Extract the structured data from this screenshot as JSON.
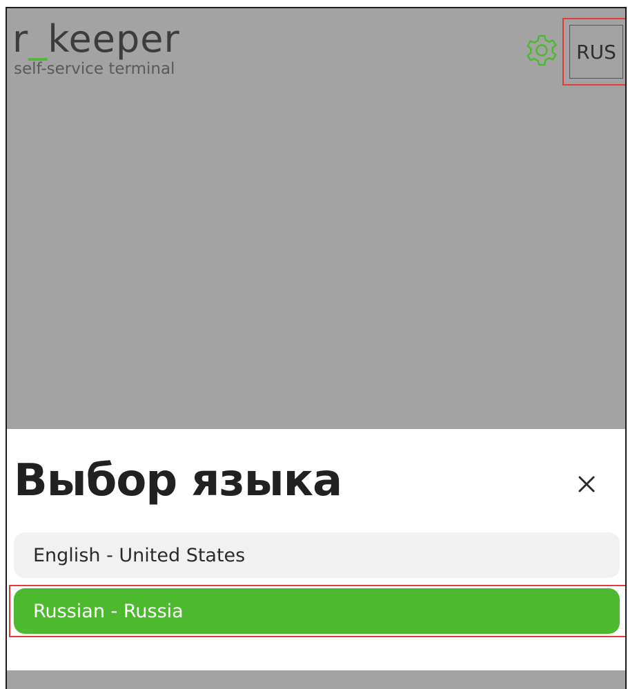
{
  "header": {
    "logo_main_prefix": "r",
    "logo_main_underscore": "_",
    "logo_main_suffix": "keeper",
    "logo_sub": "self-service terminal",
    "settings_icon": "gear-icon",
    "language_button_label": "RUS"
  },
  "language_sheet": {
    "title": "Выбор языка",
    "close_icon": "close-icon",
    "options": [
      {
        "label": "English - United States",
        "selected": false
      },
      {
        "label": "Russian - Russia",
        "selected": true
      }
    ]
  },
  "colors": {
    "accent": "#4cb92f",
    "backdrop": "#a3a3a3",
    "highlight": "#e53935"
  }
}
